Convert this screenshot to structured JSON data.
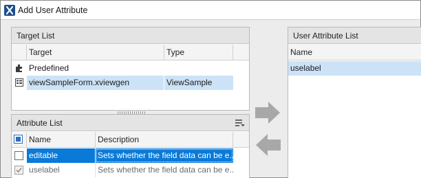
{
  "window": {
    "title": "Add User Attribute"
  },
  "target_list": {
    "title": "Target List",
    "columns": [
      "Target",
      "Type"
    ],
    "rows": [
      {
        "target": "Predefined",
        "type": "",
        "icon": "puzzle-icon"
      },
      {
        "target": "viewSampleForm.xviewgen",
        "type": "ViewSample",
        "icon": "form-icon",
        "selected": true
      }
    ]
  },
  "attribute_list": {
    "title": "Attribute List",
    "columns": [
      "Name",
      "Description"
    ],
    "rows": [
      {
        "name": "editable",
        "description": "Sets whether the field data can be e...",
        "checked": false,
        "selected": true
      },
      {
        "name": "uselabel",
        "description": "Sets whether the field data can be e...",
        "checked": true,
        "selected": false
      }
    ]
  },
  "user_attribute_list": {
    "title": "User Attribute List",
    "columns": [
      "Name"
    ],
    "rows": [
      {
        "name": "uselabel",
        "selected": true
      }
    ]
  },
  "colors": {
    "selection_light": "#cce3f7",
    "selection_dark": "#0a7ad8",
    "arrow": "#a8a8a8"
  }
}
